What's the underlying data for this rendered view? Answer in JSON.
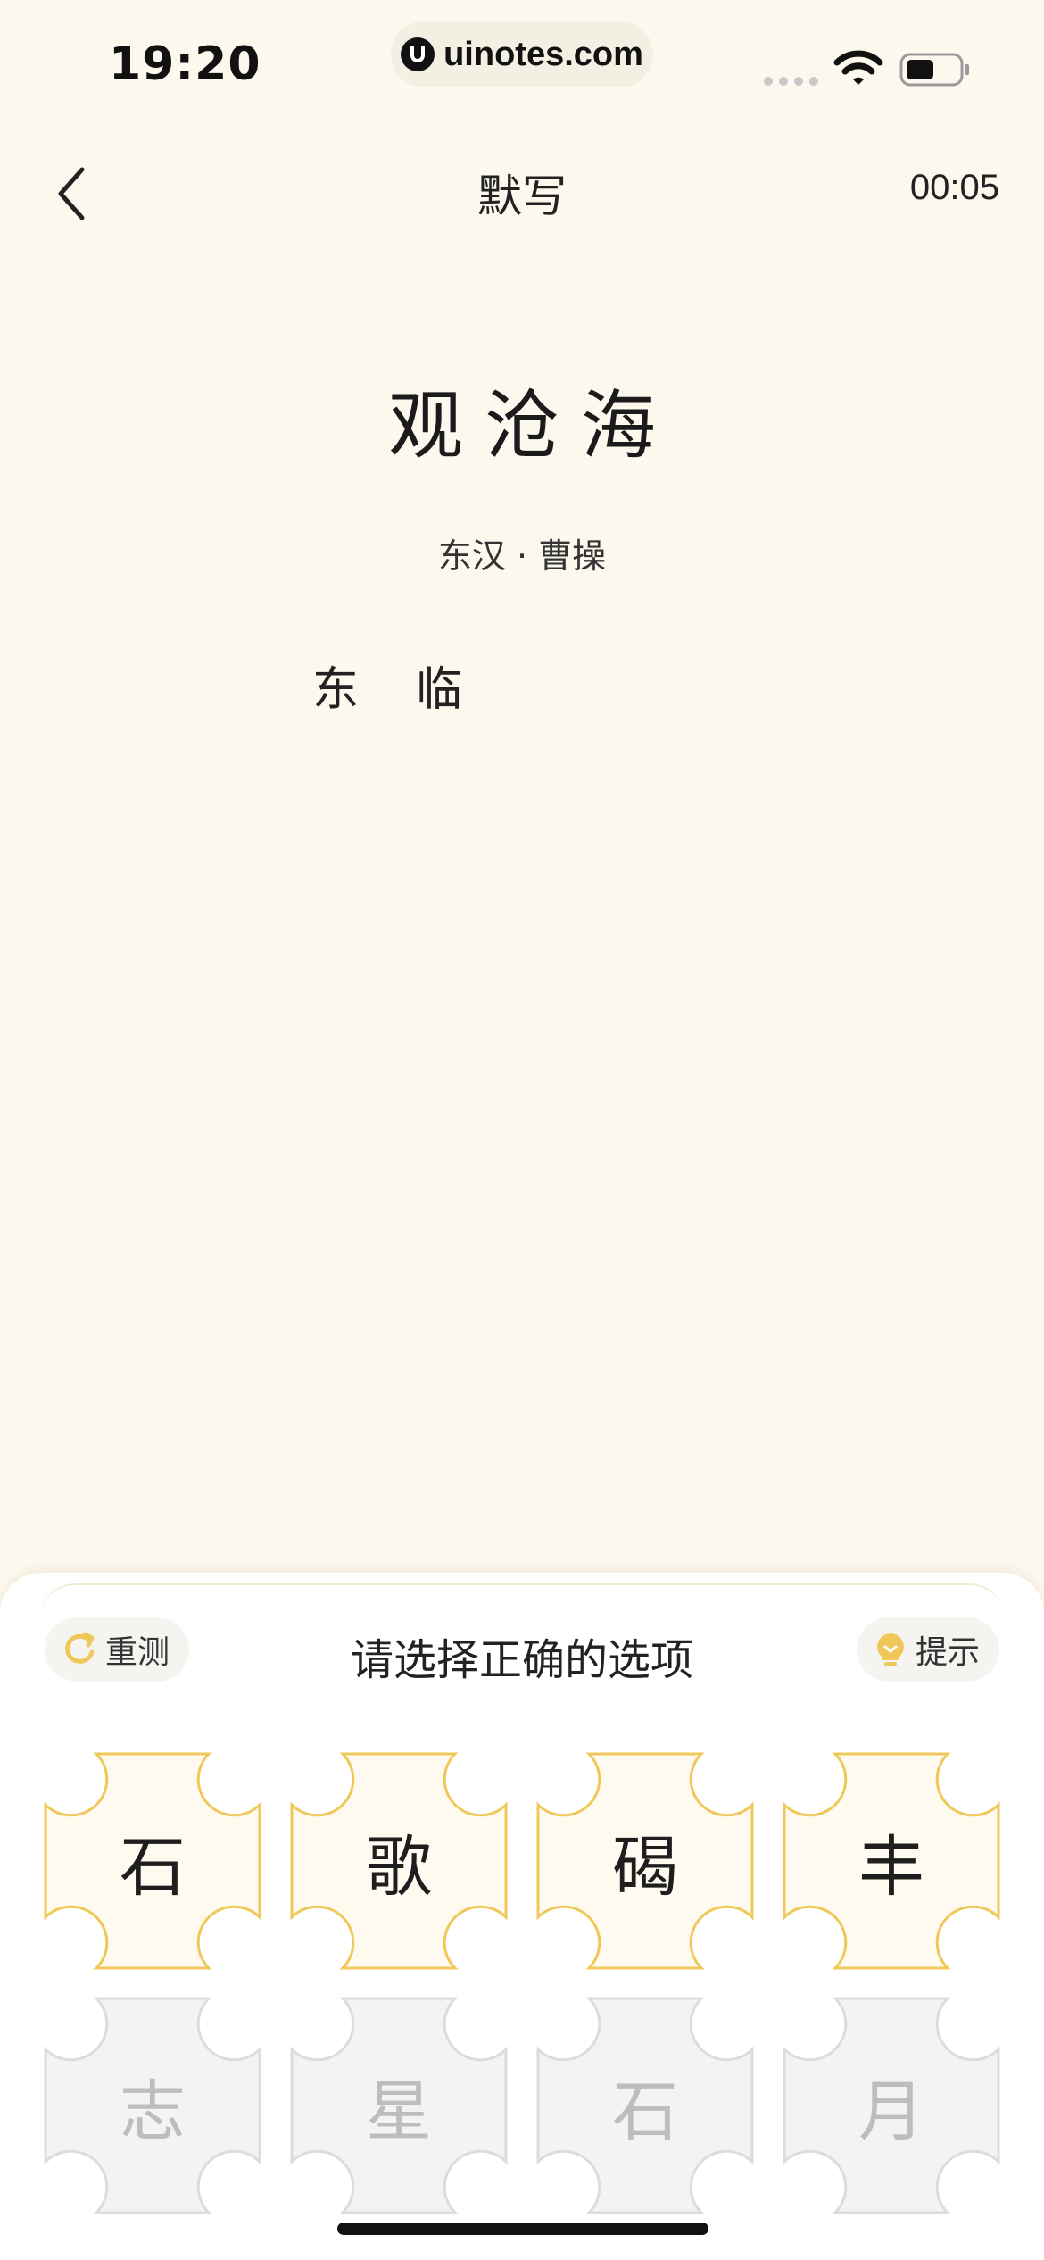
{
  "status_bar": {
    "time": "19:20",
    "url": "uinotes.com"
  },
  "nav": {
    "title": "默写",
    "timer": "00:05"
  },
  "poem": {
    "title": "观沧海",
    "author": "东汉 · 曹操",
    "answer_chars": [
      "东",
      "临"
    ]
  },
  "panel": {
    "retest_label": "重测",
    "prompt": "请选择正确的选项",
    "hint_label": "提示"
  },
  "options": {
    "active": [
      "石",
      "歌",
      "碣",
      "丰"
    ],
    "used": [
      "志",
      "星",
      "石",
      "月"
    ]
  },
  "colors": {
    "background": "#fdf8ee",
    "accent_gold": "#f0c85a",
    "option_active_fill": "#fffaf0",
    "option_used_fill": "#f2f3f4",
    "option_used_text": "#bdbdbd"
  },
  "icons": {
    "back": "chevron-left-icon",
    "retest": "refresh-icon",
    "hint": "lightbulb-icon",
    "wifi": "wifi-icon",
    "battery": "battery-icon"
  }
}
